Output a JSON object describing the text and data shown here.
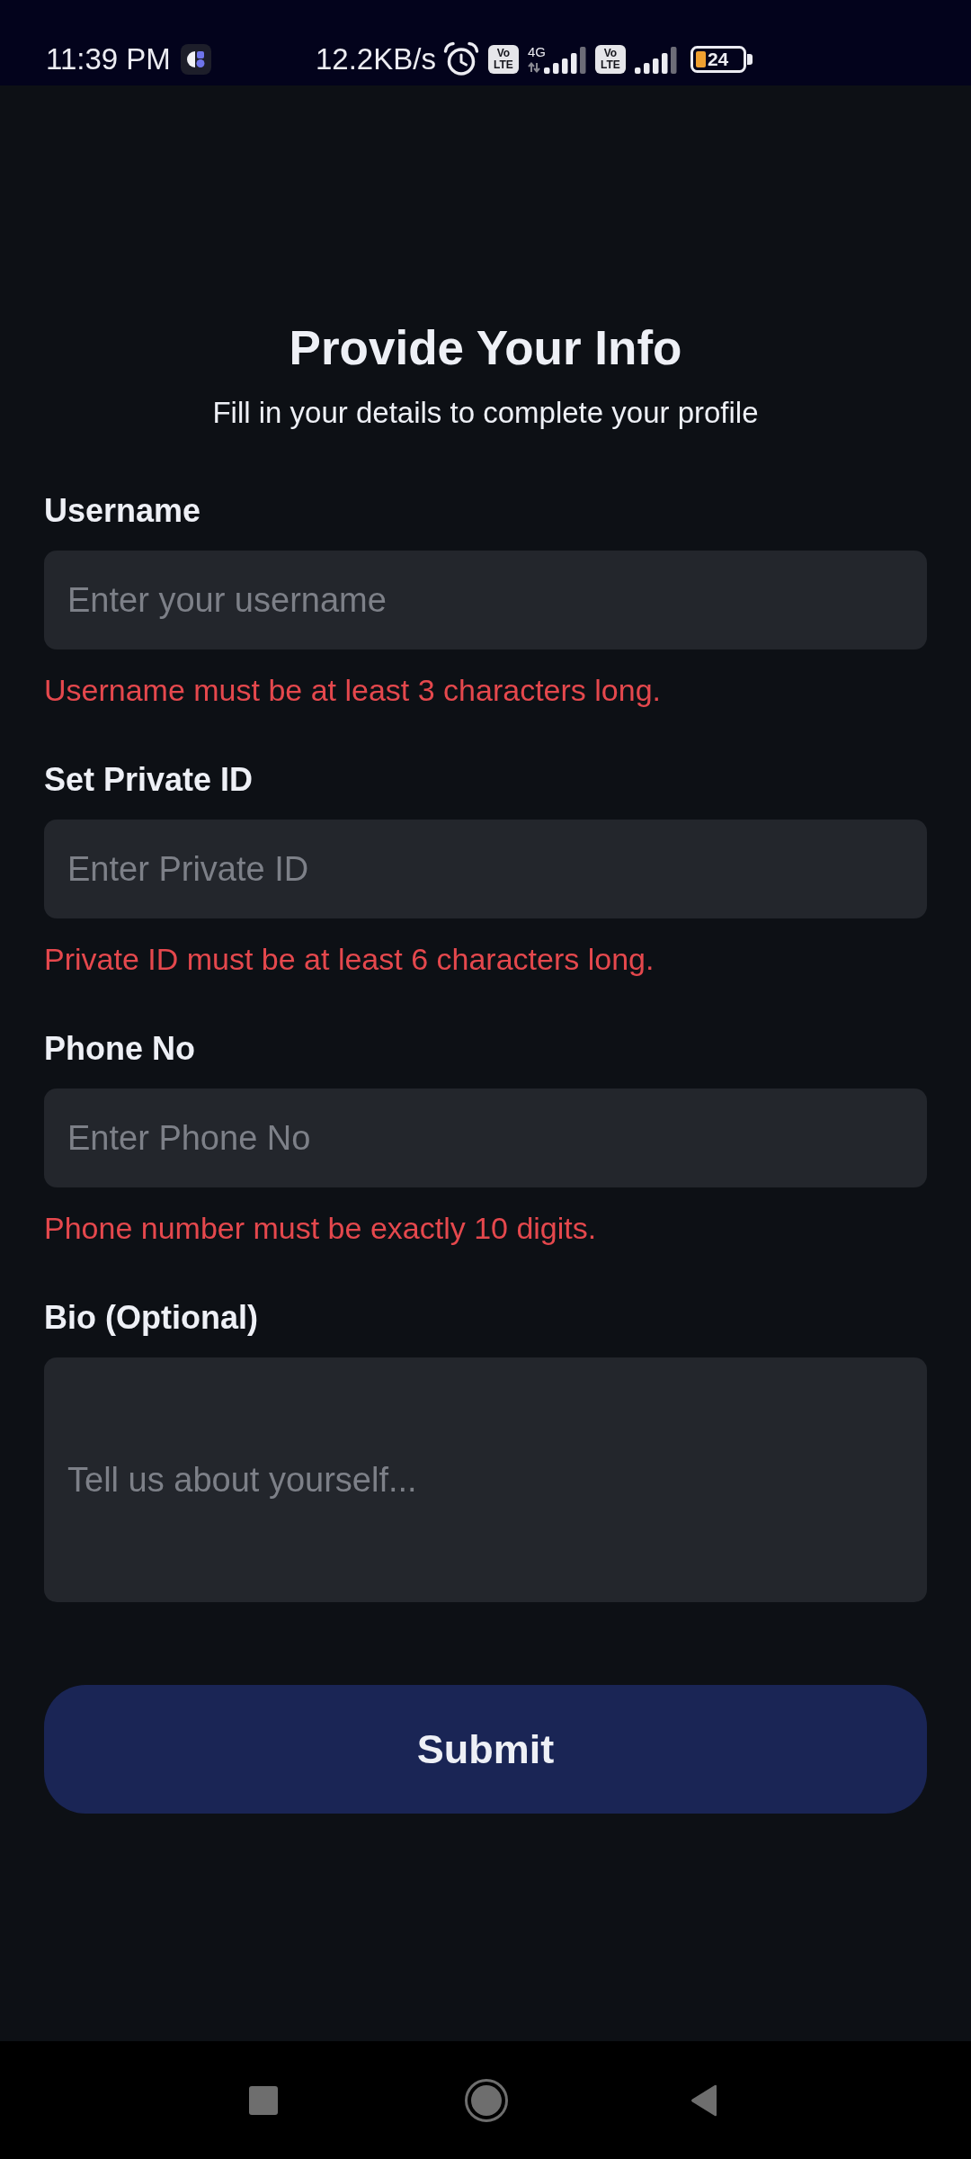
{
  "status_bar": {
    "time": "11:39 PM",
    "network_speed": "12.2KB/s",
    "sims": [
      {
        "badge_lines": [
          "Vo",
          "LTE"
        ],
        "network_type": "4G"
      },
      {
        "badge_lines": [
          "Vo",
          "LTE"
        ]
      }
    ],
    "battery_text": "24"
  },
  "header": {
    "title": "Provide Your Info",
    "subtitle": "Fill in your details to complete your profile"
  },
  "fields": [
    {
      "kind": "input",
      "label": "Username",
      "placeholder": "Enter your username",
      "error": "Username must be at least 3 characters long."
    },
    {
      "kind": "input",
      "label": "Set Private ID",
      "placeholder": "Enter Private ID",
      "error": "Private ID must be at least 6 characters long."
    },
    {
      "kind": "input",
      "label": "Phone No",
      "placeholder": "Enter Phone No",
      "error": "Phone number must be exactly 10 digits."
    },
    {
      "kind": "textarea",
      "label": "Bio (Optional)",
      "placeholder": "Tell us about yourself..."
    }
  ],
  "submit_button": {
    "label": "Submit"
  }
}
